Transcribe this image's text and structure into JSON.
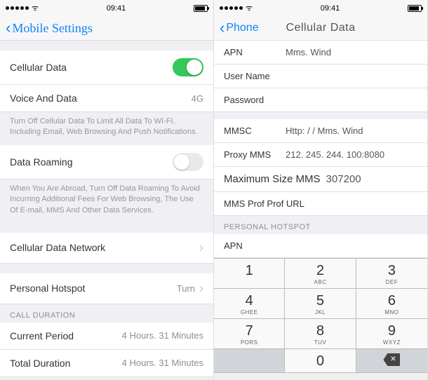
{
  "status": {
    "time": "09:41"
  },
  "left": {
    "back_label": "Mobile Settings",
    "cellular_data_label": "Cellular Data",
    "voice_data_label": "Voice And Data",
    "voice_data_value": "4G",
    "hint1": "Turn Off Cellular Data To Limit All Data To WI-FI. Including Email, Web Browsing And Push Notifications.",
    "data_roaming_label": "Data Roaming",
    "hint2": "When You Are Abroad, Turn Off Data Roaming To Avoid Incurring Additional Fees For Web Browsing, The Use Of E-mail, MMS And Other Data Services.",
    "cdn_label": "Cellular Data Network",
    "ph_label": "Personal Hotspot",
    "ph_value": "Turn",
    "call_header": "CALL DURATION",
    "cp_label": "Current Period",
    "cp_value": "4 Hours. 31 Minutes",
    "td_label": "Total Duration",
    "td_value": "4 Hours. 31 Minutes"
  },
  "right": {
    "back_label": "Phone",
    "title": "Cellular Data",
    "fields": {
      "apn_label": "APN",
      "apn_value": "Mms. Wind",
      "user_label": "User Name",
      "pass_label": "Password",
      "mmsc_label": "MMSC",
      "mmsc_value": "Http: / / Mms. Wind",
      "proxy_label": "Proxy MMS",
      "proxy_value": "212. 245. 244. 100:8080",
      "max_label": "Maximum Size MMS",
      "max_value": "307200",
      "prof_label": "MMS Prof Prof URL"
    },
    "hotspot_header": "PERSONAL HOTSPOT",
    "hotspot_apn": "APN",
    "keys": [
      {
        "n": "1",
        "l": ""
      },
      {
        "n": "2",
        "l": "ABC"
      },
      {
        "n": "3",
        "l": "DEF"
      },
      {
        "n": "4",
        "l": "Ghee"
      },
      {
        "n": "5",
        "l": "JKL"
      },
      {
        "n": "6",
        "l": "MNO"
      },
      {
        "n": "7",
        "l": "PORS"
      },
      {
        "n": "8",
        "l": "TUV"
      },
      {
        "n": "9",
        "l": "Wxyz"
      }
    ],
    "zero": "0"
  }
}
